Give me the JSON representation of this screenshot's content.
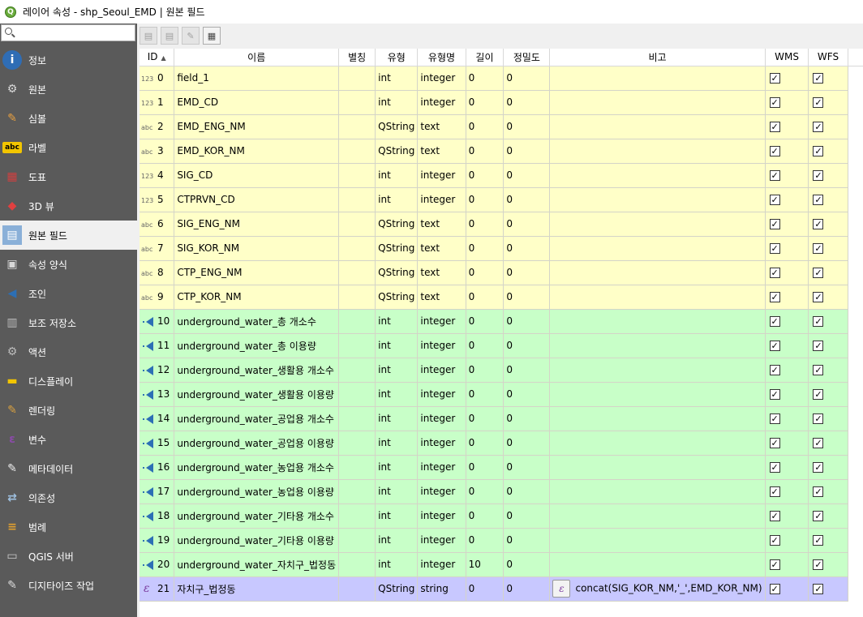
{
  "window": {
    "title": "레이어 속성 - shp_Seoul_EMD | 원본 필드",
    "logo_letter": "Q"
  },
  "search": {
    "placeholder": ""
  },
  "sidebar": {
    "items": [
      {
        "label": "정보",
        "icon": "info-icon"
      },
      {
        "label": "원본",
        "icon": "source-icon"
      },
      {
        "label": "심볼",
        "icon": "symbology-icon"
      },
      {
        "label": "라벨",
        "icon": "labels-icon"
      },
      {
        "label": "도표",
        "icon": "diagrams-icon"
      },
      {
        "label": "3D 뷰",
        "icon": "3d-view-icon"
      },
      {
        "label": "원본 필드",
        "icon": "source-fields-icon"
      },
      {
        "label": "속성 양식",
        "icon": "attributes-form-icon"
      },
      {
        "label": "조인",
        "icon": "joins-icon"
      },
      {
        "label": "보조 저장소",
        "icon": "auxiliary-storage-icon"
      },
      {
        "label": "액션",
        "icon": "actions-icon"
      },
      {
        "label": "디스플레이",
        "icon": "display-icon"
      },
      {
        "label": "렌더링",
        "icon": "rendering-icon"
      },
      {
        "label": "변수",
        "icon": "variables-icon"
      },
      {
        "label": "메타데이터",
        "icon": "metadata-icon"
      },
      {
        "label": "의존성",
        "icon": "dependencies-icon"
      },
      {
        "label": "범례",
        "icon": "legend-icon"
      },
      {
        "label": "QGIS 서버",
        "icon": "qgis-server-icon"
      },
      {
        "label": "디지타이즈 작업",
        "icon": "digitizing-icon"
      }
    ],
    "icon_glyphs": {
      "info": "i",
      "source": "⚙",
      "symbology": "✎",
      "labels": "abc",
      "diagrams": "▦",
      "3d": "◆",
      "fields": "▤",
      "form": "▣",
      "joins": "◀",
      "storage": "▥",
      "actions": "⚙",
      "display": "💬",
      "rendering": "✎",
      "variables": "ε",
      "metadata": "✎",
      "dependencies": "⇄",
      "legend": "≡",
      "server": "▭",
      "digitizing": "✎"
    },
    "active_index": 6
  },
  "toolbar": {
    "buttons": [
      {
        "name": "new-field-button",
        "glyph": "▤",
        "enabled": false
      },
      {
        "name": "delete-field-button",
        "glyph": "▤",
        "enabled": false
      },
      {
        "name": "toggle-editing-button",
        "glyph": "✎",
        "enabled": false
      },
      {
        "name": "field-calculator-button",
        "glyph": "▦",
        "enabled": true
      }
    ]
  },
  "table": {
    "headers": [
      "ID",
      "이름",
      "별칭",
      "유형",
      "유형명",
      "길이",
      "정밀도",
      "비고",
      "WMS",
      "WFS"
    ],
    "sort_indicator": "▲",
    "type_badges": {
      "int": "123",
      "string": "abc"
    },
    "checkmark": "✓",
    "rows": [
      {
        "kind": "orig",
        "badge": "123",
        "id": "0",
        "name": "field_1",
        "alias": "",
        "type": "int",
        "typename": "integer",
        "length": "0",
        "precision": "0",
        "comment": ""
      },
      {
        "kind": "orig",
        "badge": "123",
        "id": "1",
        "name": "EMD_CD",
        "alias": "",
        "type": "int",
        "typename": "integer",
        "length": "0",
        "precision": "0",
        "comment": ""
      },
      {
        "kind": "orig",
        "badge": "abc",
        "id": "2",
        "name": "EMD_ENG_NM",
        "alias": "",
        "type": "QString",
        "typename": "text",
        "length": "0",
        "precision": "0",
        "comment": ""
      },
      {
        "kind": "orig",
        "badge": "abc",
        "id": "3",
        "name": "EMD_KOR_NM",
        "alias": "",
        "type": "QString",
        "typename": "text",
        "length": "0",
        "precision": "0",
        "comment": ""
      },
      {
        "kind": "orig",
        "badge": "123",
        "id": "4",
        "name": "SIG_CD",
        "alias": "",
        "type": "int",
        "typename": "integer",
        "length": "0",
        "precision": "0",
        "comment": ""
      },
      {
        "kind": "orig",
        "badge": "123",
        "id": "5",
        "name": "CTPRVN_CD",
        "alias": "",
        "type": "int",
        "typename": "integer",
        "length": "0",
        "precision": "0",
        "comment": ""
      },
      {
        "kind": "orig",
        "badge": "abc",
        "id": "6",
        "name": "SIG_ENG_NM",
        "alias": "",
        "type": "QString",
        "typename": "text",
        "length": "0",
        "precision": "0",
        "comment": ""
      },
      {
        "kind": "orig",
        "badge": "abc",
        "id": "7",
        "name": "SIG_KOR_NM",
        "alias": "",
        "type": "QString",
        "typename": "text",
        "length": "0",
        "precision": "0",
        "comment": ""
      },
      {
        "kind": "orig",
        "badge": "abc",
        "id": "8",
        "name": "CTP_ENG_NM",
        "alias": "",
        "type": "QString",
        "typename": "text",
        "length": "0",
        "precision": "0",
        "comment": ""
      },
      {
        "kind": "orig",
        "badge": "abc",
        "id": "9",
        "name": "CTP_KOR_NM",
        "alias": "",
        "type": "QString",
        "typename": "text",
        "length": "0",
        "precision": "0",
        "comment": ""
      },
      {
        "kind": "join",
        "badge": "",
        "id": "10",
        "name": "underground_water_총 개소수",
        "alias": "",
        "type": "int",
        "typename": "integer",
        "length": "0",
        "precision": "0",
        "comment": ""
      },
      {
        "kind": "join",
        "badge": "",
        "id": "11",
        "name": "underground_water_총 이용량",
        "alias": "",
        "type": "int",
        "typename": "integer",
        "length": "0",
        "precision": "0",
        "comment": ""
      },
      {
        "kind": "join",
        "badge": "",
        "id": "12",
        "name": "underground_water_생활용 개소수",
        "alias": "",
        "type": "int",
        "typename": "integer",
        "length": "0",
        "precision": "0",
        "comment": ""
      },
      {
        "kind": "join",
        "badge": "",
        "id": "13",
        "name": "underground_water_생활용 이용량",
        "alias": "",
        "type": "int",
        "typename": "integer",
        "length": "0",
        "precision": "0",
        "comment": ""
      },
      {
        "kind": "join",
        "badge": "",
        "id": "14",
        "name": "underground_water_공업용 개소수",
        "alias": "",
        "type": "int",
        "typename": "integer",
        "length": "0",
        "precision": "0",
        "comment": ""
      },
      {
        "kind": "join",
        "badge": "",
        "id": "15",
        "name": "underground_water_공업용 이용량",
        "alias": "",
        "type": "int",
        "typename": "integer",
        "length": "0",
        "precision": "0",
        "comment": ""
      },
      {
        "kind": "join",
        "badge": "",
        "id": "16",
        "name": "underground_water_농업용 개소수",
        "alias": "",
        "type": "int",
        "typename": "integer",
        "length": "0",
        "precision": "0",
        "comment": ""
      },
      {
        "kind": "join",
        "badge": "",
        "id": "17",
        "name": "underground_water_농업용 이용량",
        "alias": "",
        "type": "int",
        "typename": "integer",
        "length": "0",
        "precision": "0",
        "comment": ""
      },
      {
        "kind": "join",
        "badge": "",
        "id": "18",
        "name": "underground_water_기타용 개소수",
        "alias": "",
        "type": "int",
        "typename": "integer",
        "length": "0",
        "precision": "0",
        "comment": ""
      },
      {
        "kind": "join",
        "badge": "",
        "id": "19",
        "name": "underground_water_기타용 이용량",
        "alias": "",
        "type": "int",
        "typename": "integer",
        "length": "0",
        "precision": "0",
        "comment": ""
      },
      {
        "kind": "join",
        "badge": "",
        "id": "20",
        "name": "underground_water_자치구_법정동",
        "alias": "",
        "type": "int",
        "typename": "integer",
        "length": "10",
        "precision": "0",
        "comment": ""
      },
      {
        "kind": "expr",
        "badge": "ε",
        "id": "21",
        "name": "자치구_법정동",
        "alias": "",
        "type": "QString",
        "typename": "string",
        "length": "0",
        "precision": "0",
        "comment": "concat(SIG_KOR_NM,'_',EMD_KOR_NM)"
      }
    ]
  },
  "colors": {
    "original_row": "#ffffc8",
    "joined_row": "#c8ffc8",
    "expression_row": "#c8c8ff",
    "sidebar_bg": "#5a5a5a"
  }
}
